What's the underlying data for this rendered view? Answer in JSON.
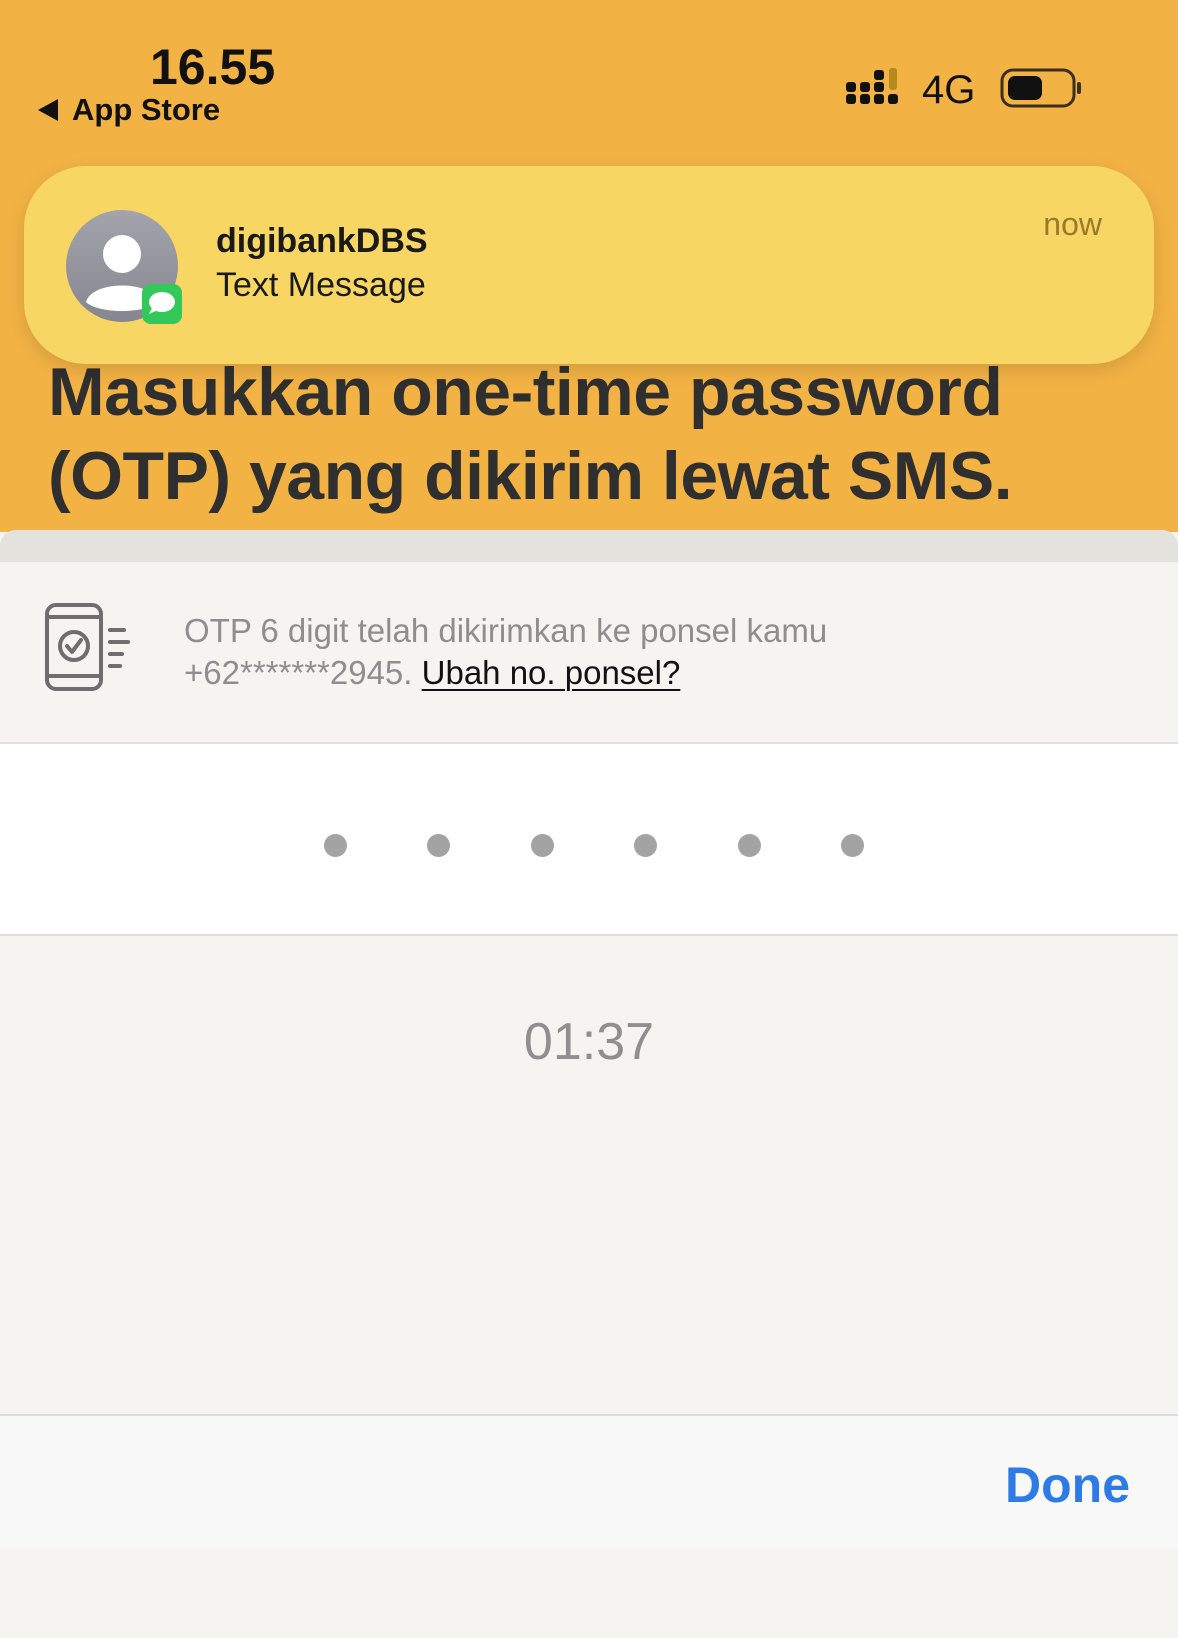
{
  "status_bar": {
    "time": "16.55",
    "back_app": "App Store",
    "network": "4G"
  },
  "notification": {
    "sender": "digibankDBS",
    "subtitle": "Text Message",
    "time": "now",
    "icon": "messages-icon"
  },
  "page": {
    "heading": "Masukkan one-time password (OTP) yang dikirim lewat SMS."
  },
  "otp_info": {
    "message": "OTP 6 digit telah dikirimkan ke ponsel kamu",
    "phone": "+62*******2945.",
    "change_link": "Ubah no. ponsel?",
    "icon": "phone-check-icon"
  },
  "otp_input": {
    "digits": 6
  },
  "timer": {
    "value": "01:37"
  },
  "keyboard_bar": {
    "done_label": "Done"
  },
  "colors": {
    "header_bg": "#f2b244",
    "notification_bg": "#f8d664",
    "done_blue": "#2f7be6",
    "messages_green": "#34c759"
  }
}
